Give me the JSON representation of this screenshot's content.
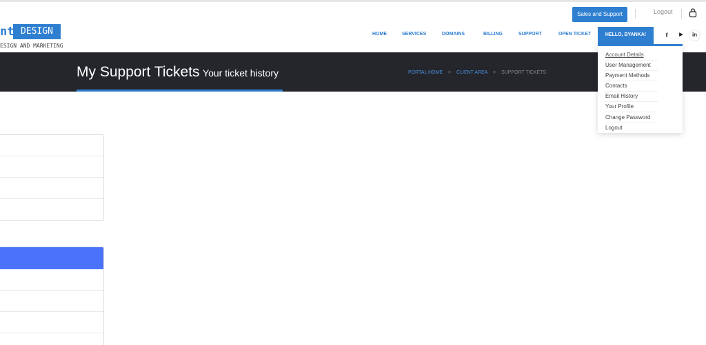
{
  "topbar": {
    "sales_button": "Sales and Support",
    "logout": "Logout",
    "cart_icon": "shopping-bag-icon"
  },
  "logo": {
    "text_fragment": "nt",
    "box_text": "DESIGN",
    "tagline": "ESIGN AND MARKETING"
  },
  "nav": {
    "items": [
      "HOME",
      "SERVICES",
      "DOMAINS",
      "BILLING",
      "SUPPORT",
      "OPEN TICKET"
    ],
    "user_menu": "HELLO, BYANKA!",
    "social_icons": [
      "facebook-icon",
      "youtube-icon",
      "linkedin-icon"
    ],
    "social_glyphs": [
      "f",
      "▶",
      "in"
    ]
  },
  "hero": {
    "title": "My Support Tickets",
    "subtitle": "Your ticket history"
  },
  "breadcrumb": {
    "items": [
      "PORTAL HOME",
      "CLIENT AREA"
    ],
    "current": "SUPPORT TICKETS",
    "separator": ">"
  },
  "account_dropdown": {
    "items": [
      "Account Details",
      "User Management",
      "Payment Methods",
      "Contacts",
      "Email History",
      "Your Profile",
      "Change Password",
      "Logout"
    ]
  },
  "colors": {
    "accent": "#2f7fd1",
    "hero_bg": "#24262b",
    "panel_header": "#4a72fb"
  }
}
